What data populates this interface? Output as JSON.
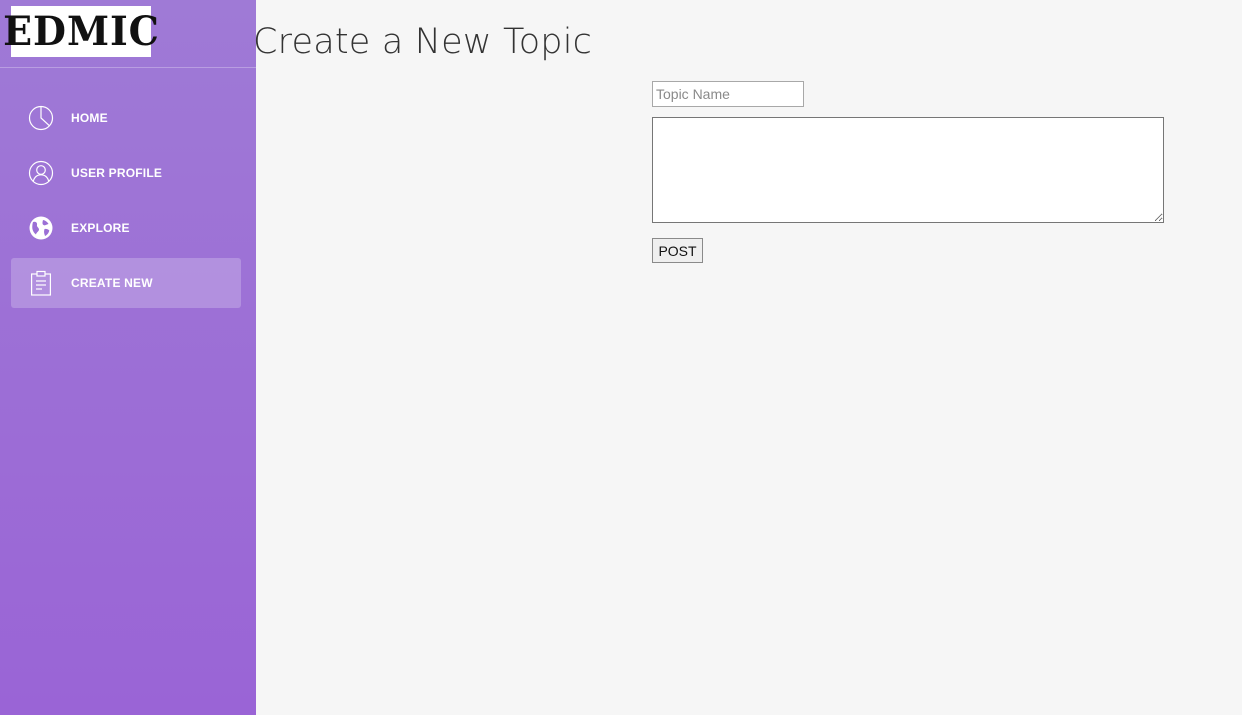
{
  "brand": {
    "logo_text": "EDMIC"
  },
  "sidebar": {
    "items": [
      {
        "label": "HOME",
        "icon": "pie-chart-icon",
        "active": false
      },
      {
        "label": "USER PROFILE",
        "icon": "user-icon",
        "active": false
      },
      {
        "label": "EXPLORE",
        "icon": "globe-icon",
        "active": false
      },
      {
        "label": "CREATE NEW",
        "icon": "clipboard-icon",
        "active": true
      }
    ]
  },
  "main": {
    "title": "Create a New Topic",
    "form": {
      "topic_name_value": "",
      "topic_name_placeholder": "Topic Name",
      "body_value": "",
      "submit_label": "POST"
    }
  },
  "colors": {
    "sidebar_top": "#9f7ad6",
    "sidebar_bottom": "#9a64d6",
    "page_background": "#f6f6f6",
    "title_text": "#333333"
  }
}
